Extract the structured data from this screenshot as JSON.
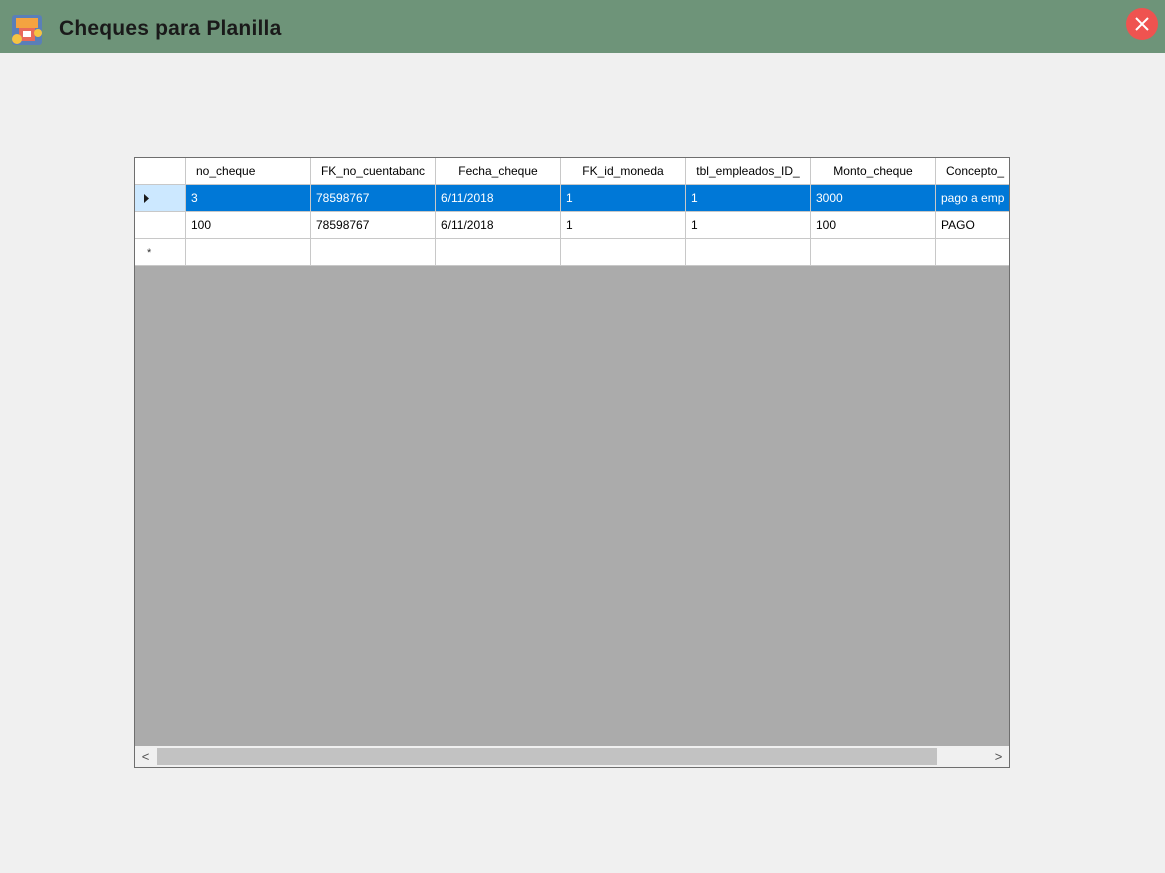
{
  "window": {
    "title": "Cheques para Planilla",
    "close_label": "×"
  },
  "grid": {
    "columns": [
      "no_cheque",
      "FK_no_cuentabanc",
      "Fecha_cheque",
      "FK_id_moneda",
      "tbl_empleados_ID_",
      "Monto_cheque",
      "Concepto_"
    ],
    "rows": [
      {
        "selected": true,
        "marker": "current-row",
        "cells": [
          "3",
          "78598767",
          "6/11/2018",
          "1",
          "1",
          "3000",
          "pago a emp"
        ]
      },
      {
        "selected": false,
        "marker": "",
        "cells": [
          "100",
          "78598767",
          "6/11/2018",
          "1",
          "1",
          "100",
          "PAGO"
        ]
      }
    ],
    "new_row_marker": "*"
  },
  "scrollbar": {
    "left_arrow": "<",
    "right_arrow": ">"
  },
  "colors": {
    "titlebar": "#6e9479",
    "selection": "#0078d7",
    "grid_background": "#ababab",
    "close_button": "#ef5350"
  }
}
